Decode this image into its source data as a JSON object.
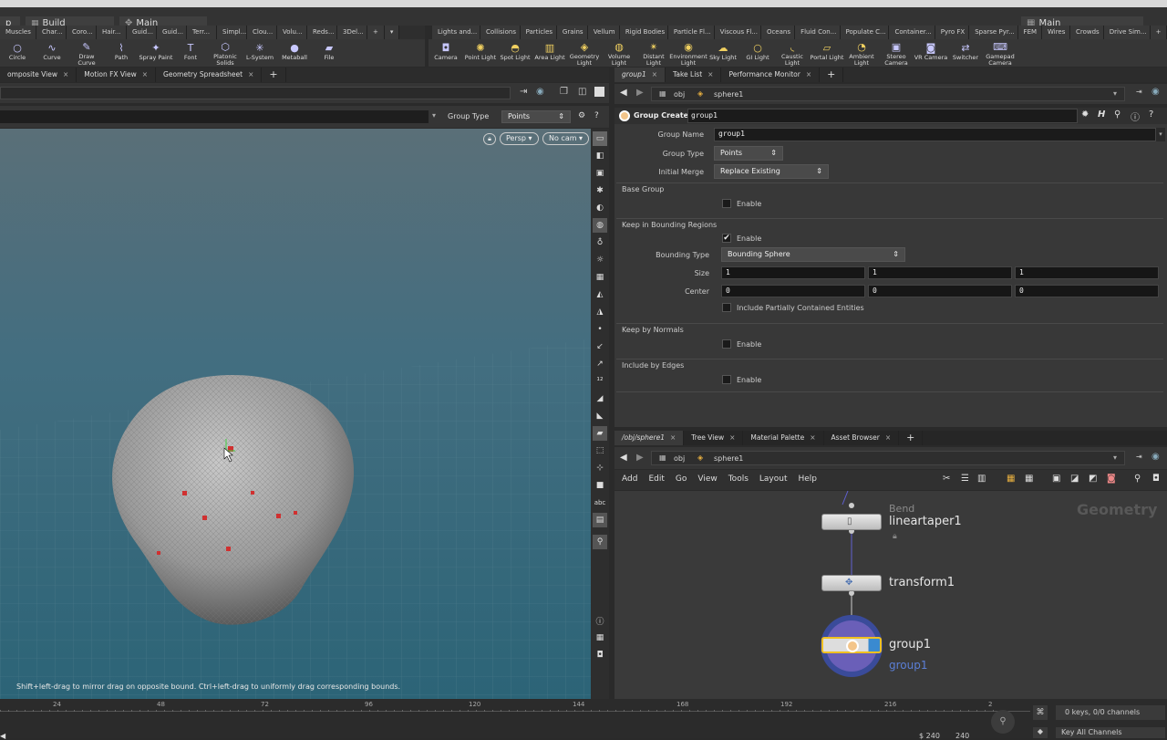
{
  "desktops": {
    "left": "p",
    "build": "Build",
    "main": "Main",
    "right_main": "Main"
  },
  "shelf_left_tabs": [
    "Muscles",
    "Char...",
    "Coro...",
    "Hair...",
    "Guid...",
    "Guid...",
    "Terr...",
    "Simpl...",
    "Clou...",
    "Volu...",
    "Reds...",
    "3Del..."
  ],
  "shelf_left_tools": [
    {
      "label": "Circle",
      "icon": "circle-icon"
    },
    {
      "label": "Curve",
      "icon": "curve-icon"
    },
    {
      "label": "Draw Curve",
      "icon": "draw-curve-icon"
    },
    {
      "label": "Path",
      "icon": "path-icon"
    },
    {
      "label": "Spray Paint",
      "icon": "spray-paint-icon"
    },
    {
      "label": "Font",
      "icon": "font-icon"
    },
    {
      "label": "Platonic Solids",
      "icon": "platonic-solids-icon"
    },
    {
      "label": "L-System",
      "icon": "l-system-icon"
    },
    {
      "label": "Metaball",
      "icon": "metaball-icon"
    },
    {
      "label": "File",
      "icon": "file-icon"
    }
  ],
  "shelf_right_tabs": [
    "Lights and...",
    "Collisions",
    "Particles",
    "Grains",
    "Vellum",
    "Rigid Bodies",
    "Particle Fl...",
    "Viscous Fl...",
    "Oceans",
    "Fluid Con...",
    "Populate C...",
    "Container...",
    "Pyro FX",
    "Sparse Pyr...",
    "FEM",
    "Wires",
    "Crowds",
    "Drive Sim..."
  ],
  "shelf_right_tools": [
    {
      "label": "Camera",
      "icon": "camera-icon"
    },
    {
      "label": "Point Light",
      "icon": "point-light-icon"
    },
    {
      "label": "Spot Light",
      "icon": "spot-light-icon"
    },
    {
      "label": "Area Light",
      "icon": "area-light-icon"
    },
    {
      "label": "Geometry Light",
      "icon": "geometry-light-icon"
    },
    {
      "label": "Volume Light",
      "icon": "volume-light-icon"
    },
    {
      "label": "Distant Light",
      "icon": "distant-light-icon"
    },
    {
      "label": "Environment Light",
      "icon": "environment-light-icon"
    },
    {
      "label": "Sky Light",
      "icon": "sky-light-icon"
    },
    {
      "label": "GI Light",
      "icon": "gi-light-icon"
    },
    {
      "label": "Caustic Light",
      "icon": "caustic-light-icon"
    },
    {
      "label": "Portal Light",
      "icon": "portal-light-icon"
    },
    {
      "label": "Ambient Light",
      "icon": "ambient-light-icon"
    },
    {
      "label": "Stereo Camera",
      "icon": "stereo-camera-icon"
    },
    {
      "label": "VR Camera",
      "icon": "vr-camera-icon"
    },
    {
      "label": "Switcher",
      "icon": "switcher-icon"
    },
    {
      "label": "Gamepad Camera",
      "icon": "gamepad-camera-icon"
    }
  ],
  "left_pane_tabs": [
    "omposite View",
    "Motion FX View",
    "Geometry Spreadsheet"
  ],
  "viewport": {
    "group_type_label": "Group Type",
    "group_type_value": "Points",
    "persp": "Persp",
    "cam": "No cam",
    "hint": "Shift+left-drag to mirror drag on opposite bound. Ctrl+left-drag to uniformly drag corresponding bounds."
  },
  "right_top_tabs": [
    "group1",
    "Take List",
    "Performance Monitor"
  ],
  "path": {
    "obj": "obj",
    "node": "sphere1"
  },
  "params": {
    "op_type": "Group Create",
    "op_name": "group1",
    "group_name_label": "Group Name",
    "group_name": "group1",
    "group_type_label": "Group Type",
    "group_type": "Points",
    "initial_merge_label": "Initial Merge",
    "initial_merge": "Replace Existing",
    "base_group": "Base Group",
    "enable": "Enable",
    "keep_bounding": "Keep in Bounding Regions",
    "bounding_type_label": "Bounding Type",
    "bounding_type": "Bounding Sphere",
    "size_label": "Size",
    "size": [
      "1",
      "1",
      "1"
    ],
    "center_label": "Center",
    "center": [
      "0",
      "0",
      "0"
    ],
    "include_partial": "Include Partially Contained Entities",
    "keep_normals": "Keep by Normals",
    "include_edges": "Include by Edges"
  },
  "net_tabs": [
    "/obj/sphere1",
    "Tree View",
    "Material Palette",
    "Asset Browser"
  ],
  "net_menu": [
    "Add",
    "Edit",
    "Go",
    "View",
    "Tools",
    "Layout",
    "Help"
  ],
  "network": {
    "context_label": "Geometry",
    "nodes": [
      {
        "type": "Bend",
        "name": "lineartaper1"
      },
      {
        "type": "",
        "name": "transform1"
      },
      {
        "type": "",
        "name": "group1",
        "sub": "group1"
      }
    ]
  },
  "timeline": {
    "ticks": [
      "24",
      "48",
      "72",
      "96",
      "120",
      "144",
      "168",
      "192",
      "216",
      "2"
    ],
    "keys": "0 keys, 0/0 channels",
    "key_all": "Key All Channels",
    "frame_a": "240",
    "frame_b": "240"
  },
  "colors": {
    "accent": "#f0c020",
    "node_ring": "#5a5ad0",
    "viewport_top": "#5a6f78",
    "viewport_bottom": "#2c6477"
  }
}
